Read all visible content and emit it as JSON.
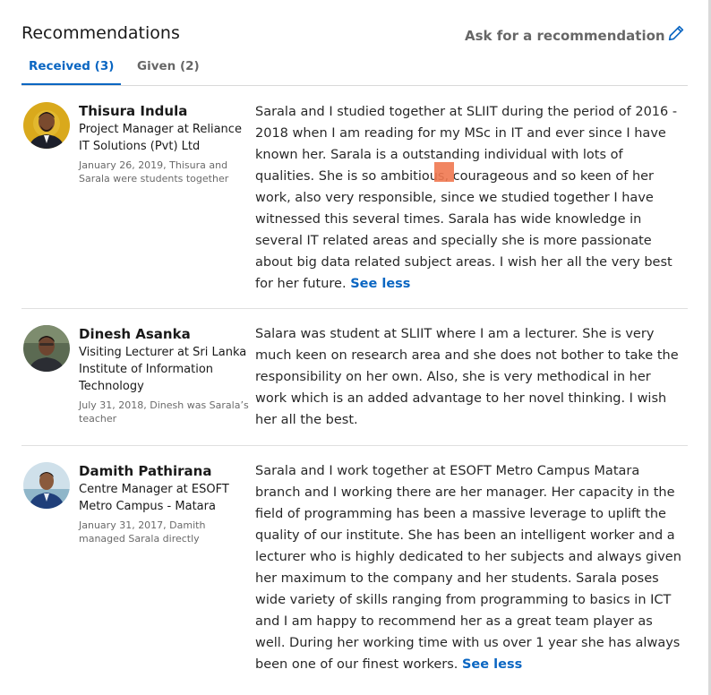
{
  "section": {
    "title": "Recommendations",
    "ask_label": "Ask for a recommendation",
    "edit_icon": "pencil-icon",
    "accent": "#0a66c2"
  },
  "tabs": [
    {
      "label": "Received (3)",
      "active": true
    },
    {
      "label": "Given (2)",
      "active": false
    }
  ],
  "recommendations": [
    {
      "name": "Thisura Indula",
      "headline": "Project Manager at Reliance IT Solutions (Pvt) Ltd",
      "meta": "January 26, 2019, Thisura and Sarala were students together",
      "text": "Sarala and I studied together at SLIIT during the period of 2016 - 2018 when I am reading for my MSc in IT and ever since I have known her. Sarala is a outstanding individual with lots of qualities. She is so ambitious, courageous and so keen of her work, also very responsible, since we studied together I have witnessed this several times. Sarala has wide knowledge in several IT related areas and specially she is more passionate about big data related subject areas. I wish her all the very best for her future.",
      "toggle": "See less"
    },
    {
      "name": "Dinesh Asanka",
      "headline": "Visiting Lecturer at Sri Lanka Institute of Information Technology",
      "meta": "July 31, 2018, Dinesh was Sarala’s teacher",
      "text": "Salara was student at SLIIT where I am a lecturer. She is very much keen on research area and she does not bother to take the responsibility on her own. Also, she is very methodical in her work which is an added advantage to her novel thinking. I wish her all the best.",
      "toggle": ""
    },
    {
      "name": "Damith Pathirana",
      "headline": "Centre Manager at ESOFT Metro Campus - Matara",
      "meta": "January 31, 2017, Damith managed Sarala directly",
      "text": "Sarala and I work together at ESOFT Metro Campus Matara branch and I working there are her manager. Her capacity in the field of programming has been a massive leverage to uplift the quality of our institute. She has been an intelligent worker and a lecturer who is highly dedicated to her subjects and always given her maximum to the company and her students. Sarala poses wide variety of skills ranging from programming to basics in ICT and I am happy to recommend her as a great team player as well. During her working time with us over 1 year she has always been one of our finest workers.",
      "toggle": "See less"
    }
  ]
}
